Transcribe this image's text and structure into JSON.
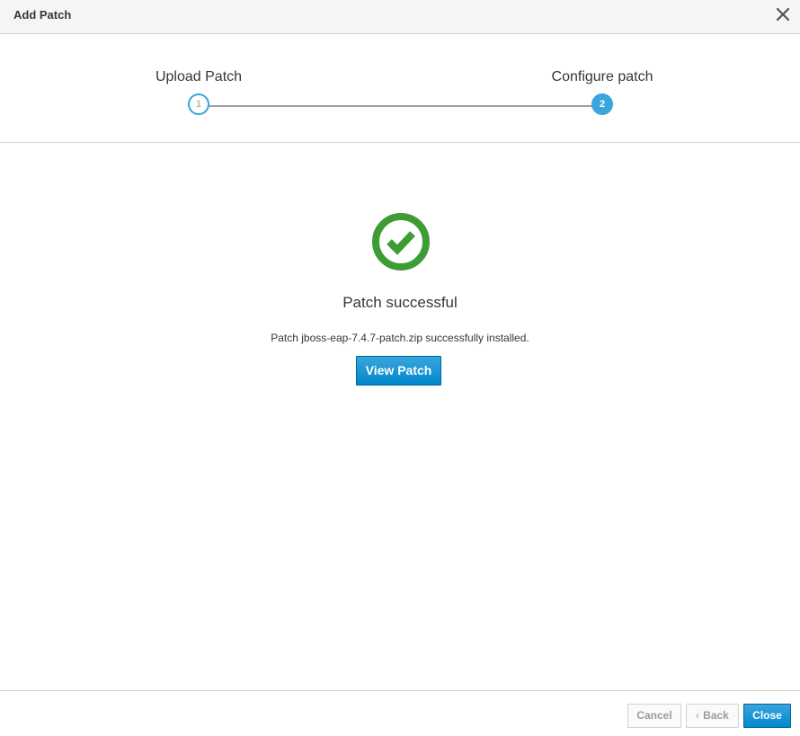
{
  "modal": {
    "title": "Add Patch",
    "close_icon": "close-icon"
  },
  "wizard": {
    "steps": [
      {
        "label": "Upload Patch",
        "number": "1",
        "state": "completed"
      },
      {
        "label": "Configure patch",
        "number": "2",
        "state": "active"
      }
    ]
  },
  "result": {
    "icon": "check-circle-icon",
    "title": "Patch successful",
    "message": "Patch jboss-eap-7.4.7-patch.zip successfully installed.",
    "view_button": "View Patch"
  },
  "footer": {
    "cancel_label": "Cancel",
    "back_chevron": "‹",
    "back_label": "Back",
    "close_label": "Close"
  },
  "colors": {
    "accent": "#39a5dc",
    "primary_button": "#0088ce",
    "success": "#3f9c35",
    "header_bg": "#f5f5f5"
  }
}
